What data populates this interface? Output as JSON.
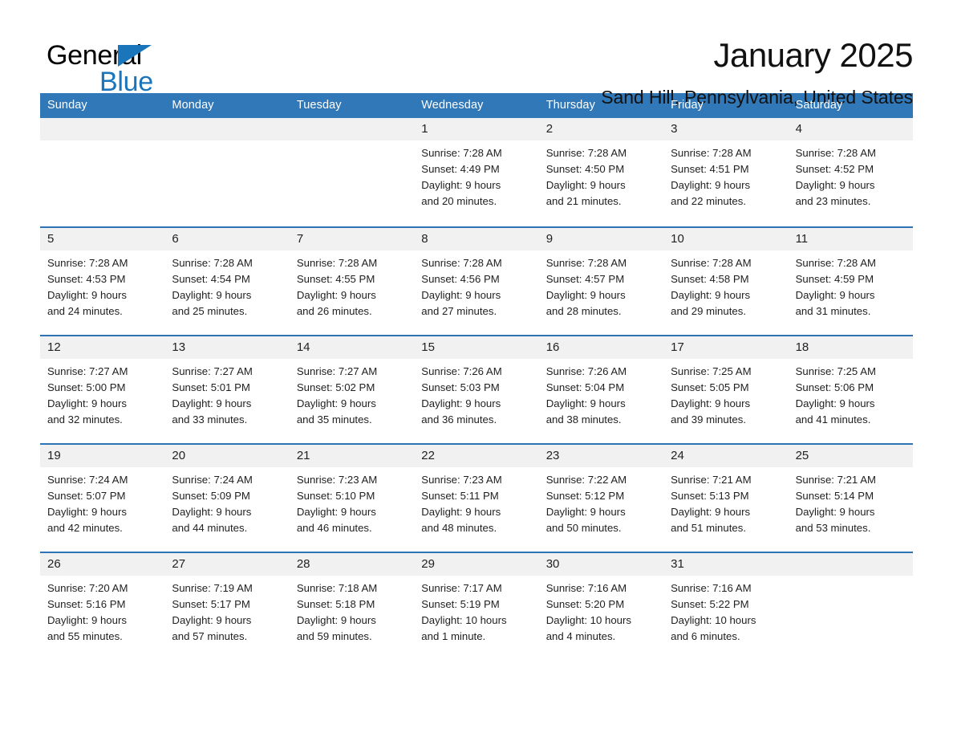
{
  "brand": {
    "name_top": "General",
    "name_bottom": "Blue",
    "accent_color": "#1b75bb"
  },
  "header": {
    "month_title": "January 2025",
    "location": "Sand Hill, Pennsylvania, United States"
  },
  "theme": {
    "header_bar_color": "#3178b8",
    "row_divider_color": "#2e74b5",
    "day_number_bg": "#f1f1f1",
    "page_bg": "#ffffff",
    "text_color": "#1f1f1f"
  },
  "weekday_headers": [
    "Sunday",
    "Monday",
    "Tuesday",
    "Wednesday",
    "Thursday",
    "Friday",
    "Saturday"
  ],
  "weeks": [
    [
      {
        "day": "",
        "info": ""
      },
      {
        "day": "",
        "info": ""
      },
      {
        "day": "",
        "info": ""
      },
      {
        "day": "1",
        "info": "Sunrise: 7:28 AM\nSunset: 4:49 PM\nDaylight: 9 hours\nand 20 minutes."
      },
      {
        "day": "2",
        "info": "Sunrise: 7:28 AM\nSunset: 4:50 PM\nDaylight: 9 hours\nand 21 minutes."
      },
      {
        "day": "3",
        "info": "Sunrise: 7:28 AM\nSunset: 4:51 PM\nDaylight: 9 hours\nand 22 minutes."
      },
      {
        "day": "4",
        "info": "Sunrise: 7:28 AM\nSunset: 4:52 PM\nDaylight: 9 hours\nand 23 minutes."
      }
    ],
    [
      {
        "day": "5",
        "info": "Sunrise: 7:28 AM\nSunset: 4:53 PM\nDaylight: 9 hours\nand 24 minutes."
      },
      {
        "day": "6",
        "info": "Sunrise: 7:28 AM\nSunset: 4:54 PM\nDaylight: 9 hours\nand 25 minutes."
      },
      {
        "day": "7",
        "info": "Sunrise: 7:28 AM\nSunset: 4:55 PM\nDaylight: 9 hours\nand 26 minutes."
      },
      {
        "day": "8",
        "info": "Sunrise: 7:28 AM\nSunset: 4:56 PM\nDaylight: 9 hours\nand 27 minutes."
      },
      {
        "day": "9",
        "info": "Sunrise: 7:28 AM\nSunset: 4:57 PM\nDaylight: 9 hours\nand 28 minutes."
      },
      {
        "day": "10",
        "info": "Sunrise: 7:28 AM\nSunset: 4:58 PM\nDaylight: 9 hours\nand 29 minutes."
      },
      {
        "day": "11",
        "info": "Sunrise: 7:28 AM\nSunset: 4:59 PM\nDaylight: 9 hours\nand 31 minutes."
      }
    ],
    [
      {
        "day": "12",
        "info": "Sunrise: 7:27 AM\nSunset: 5:00 PM\nDaylight: 9 hours\nand 32 minutes."
      },
      {
        "day": "13",
        "info": "Sunrise: 7:27 AM\nSunset: 5:01 PM\nDaylight: 9 hours\nand 33 minutes."
      },
      {
        "day": "14",
        "info": "Sunrise: 7:27 AM\nSunset: 5:02 PM\nDaylight: 9 hours\nand 35 minutes."
      },
      {
        "day": "15",
        "info": "Sunrise: 7:26 AM\nSunset: 5:03 PM\nDaylight: 9 hours\nand 36 minutes."
      },
      {
        "day": "16",
        "info": "Sunrise: 7:26 AM\nSunset: 5:04 PM\nDaylight: 9 hours\nand 38 minutes."
      },
      {
        "day": "17",
        "info": "Sunrise: 7:25 AM\nSunset: 5:05 PM\nDaylight: 9 hours\nand 39 minutes."
      },
      {
        "day": "18",
        "info": "Sunrise: 7:25 AM\nSunset: 5:06 PM\nDaylight: 9 hours\nand 41 minutes."
      }
    ],
    [
      {
        "day": "19",
        "info": "Sunrise: 7:24 AM\nSunset: 5:07 PM\nDaylight: 9 hours\nand 42 minutes."
      },
      {
        "day": "20",
        "info": "Sunrise: 7:24 AM\nSunset: 5:09 PM\nDaylight: 9 hours\nand 44 minutes."
      },
      {
        "day": "21",
        "info": "Sunrise: 7:23 AM\nSunset: 5:10 PM\nDaylight: 9 hours\nand 46 minutes."
      },
      {
        "day": "22",
        "info": "Sunrise: 7:23 AM\nSunset: 5:11 PM\nDaylight: 9 hours\nand 48 minutes."
      },
      {
        "day": "23",
        "info": "Sunrise: 7:22 AM\nSunset: 5:12 PM\nDaylight: 9 hours\nand 50 minutes."
      },
      {
        "day": "24",
        "info": "Sunrise: 7:21 AM\nSunset: 5:13 PM\nDaylight: 9 hours\nand 51 minutes."
      },
      {
        "day": "25",
        "info": "Sunrise: 7:21 AM\nSunset: 5:14 PM\nDaylight: 9 hours\nand 53 minutes."
      }
    ],
    [
      {
        "day": "26",
        "info": "Sunrise: 7:20 AM\nSunset: 5:16 PM\nDaylight: 9 hours\nand 55 minutes."
      },
      {
        "day": "27",
        "info": "Sunrise: 7:19 AM\nSunset: 5:17 PM\nDaylight: 9 hours\nand 57 minutes."
      },
      {
        "day": "28",
        "info": "Sunrise: 7:18 AM\nSunset: 5:18 PM\nDaylight: 9 hours\nand 59 minutes."
      },
      {
        "day": "29",
        "info": "Sunrise: 7:17 AM\nSunset: 5:19 PM\nDaylight: 10 hours\nand 1 minute."
      },
      {
        "day": "30",
        "info": "Sunrise: 7:16 AM\nSunset: 5:20 PM\nDaylight: 10 hours\nand 4 minutes."
      },
      {
        "day": "31",
        "info": "Sunrise: 7:16 AM\nSunset: 5:22 PM\nDaylight: 10 hours\nand 6 minutes."
      },
      {
        "day": "",
        "info": ""
      }
    ]
  ]
}
